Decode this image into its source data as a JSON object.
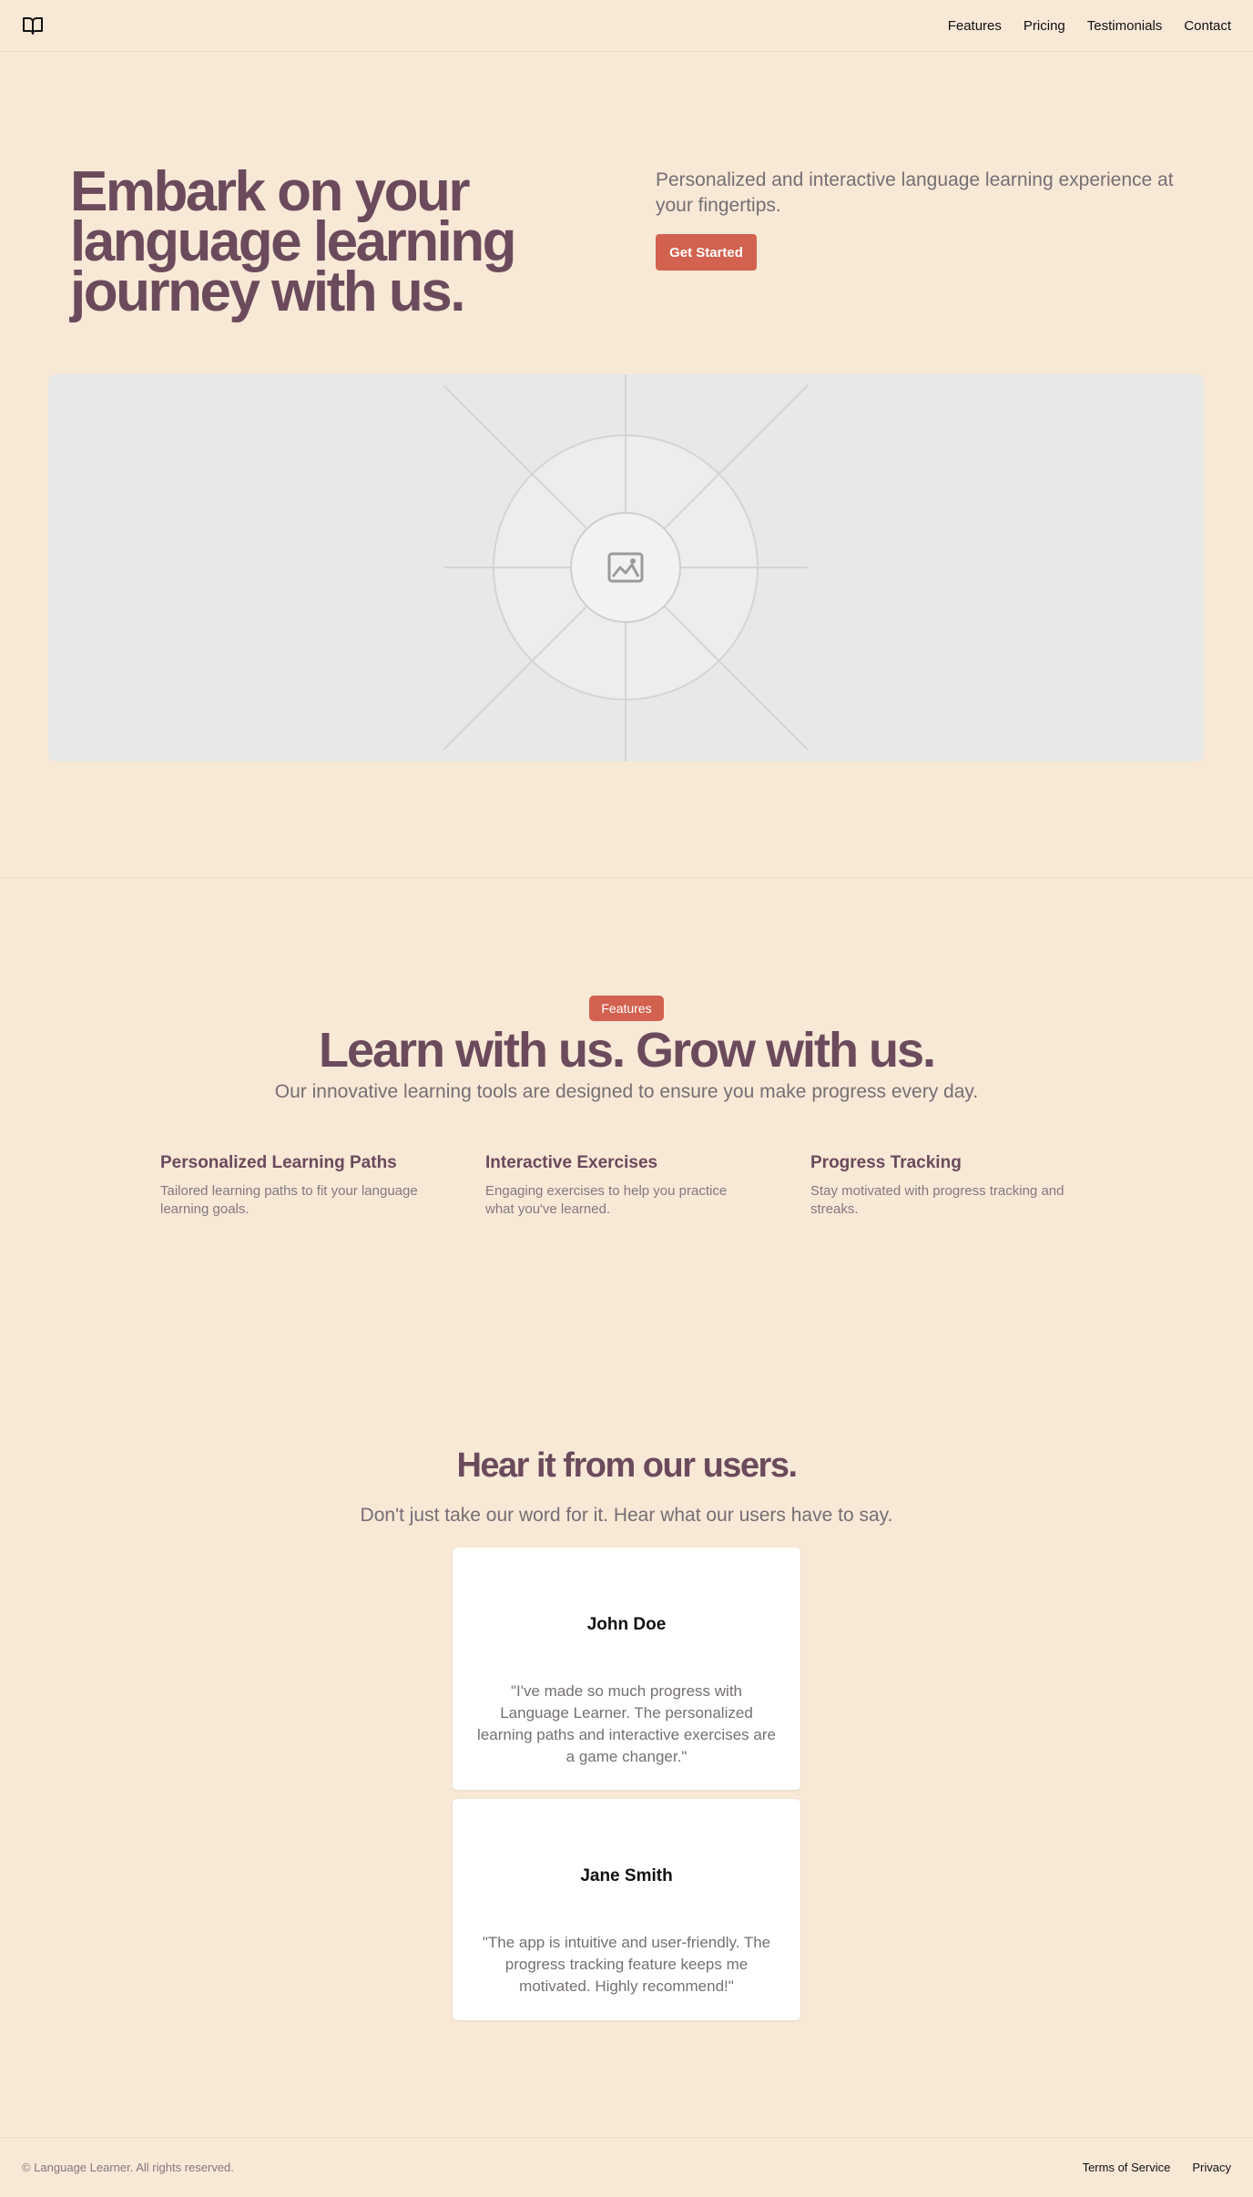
{
  "header": {
    "logo_icon": "book-open-icon",
    "nav": [
      "Features",
      "Pricing",
      "Testimonials",
      "Contact"
    ]
  },
  "hero": {
    "title": "Embark on your language learning journey with us.",
    "subtitle": "Personalized and interactive language learning experience at your fingertips.",
    "cta_label": "Get Started",
    "image_icon": "image-placeholder-icon"
  },
  "features": {
    "badge": "Features",
    "title": "Learn with us. Grow with us.",
    "subtitle": "Our innovative learning tools are designed to ensure you make progress every day.",
    "items": [
      {
        "title": "Personalized Learning Paths",
        "description": "Tailored learning paths to fit your language learning goals."
      },
      {
        "title": "Interactive Exercises",
        "description": "Engaging exercises to help you practice what you've learned."
      },
      {
        "title": "Progress Tracking",
        "description": "Stay motivated with progress tracking and streaks."
      }
    ]
  },
  "testimonials": {
    "title": "Hear it from our users.",
    "subtitle": "Don't just take our word for it. Hear what our users have to say.",
    "items": [
      {
        "name": "John Doe",
        "quote": "\"I've made so much progress with Language Learner. The personalized learning paths and interactive exercises are a game changer.\""
      },
      {
        "name": "Jane Smith",
        "quote": "\"The app is intuitive and user-friendly. The progress tracking feature keeps me motivated. Highly recommend!\""
      }
    ]
  },
  "footer": {
    "copyright": "© Language Learner. All rights reserved.",
    "links": [
      "Terms of Service",
      "Privacy"
    ]
  },
  "colors": {
    "background": "#f8e8d6",
    "heading": "#6b4a5b",
    "accent": "#d3614f",
    "muted_text": "#756f73"
  }
}
